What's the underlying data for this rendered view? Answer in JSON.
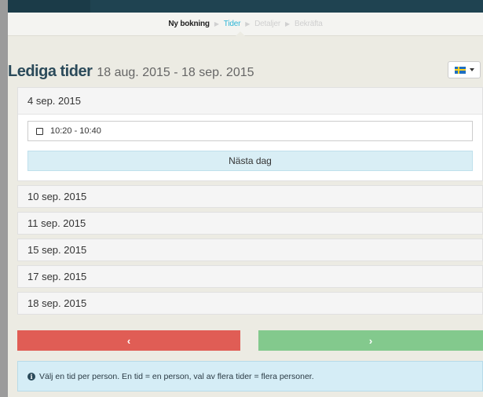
{
  "steps": [
    {
      "label": "Ny bokning",
      "state": "done"
    },
    {
      "label": "Tider",
      "state": "active"
    },
    {
      "label": "Detaljer",
      "state": "pending"
    },
    {
      "label": "Bekräfta",
      "state": "pending"
    }
  ],
  "heading": {
    "title": "Lediga tider",
    "range": "18 aug. 2015 - 18 sep. 2015"
  },
  "language": {
    "icon": "swedish-flag-icon"
  },
  "days": {
    "open": {
      "date": "4 sep. 2015",
      "slot": "10:20 - 10:40",
      "next_day": "Nästa dag"
    },
    "closed": [
      "10 sep. 2015",
      "11 sep. 2015",
      "15 sep. 2015",
      "17 sep. 2015",
      "18 sep. 2015"
    ]
  },
  "nav": {
    "prev_label": "‹",
    "next_label": "›"
  },
  "info": {
    "icon_glyph": "i",
    "text": "Välj en tid per person. En tid = en person, val av flera tider = flera personer."
  },
  "colors": {
    "topbar": "#1f4351",
    "active_step": "#2eb6d6",
    "prev_button": "#e05d55",
    "next_button": "#83c98d",
    "info_bg": "#d5edf6"
  }
}
